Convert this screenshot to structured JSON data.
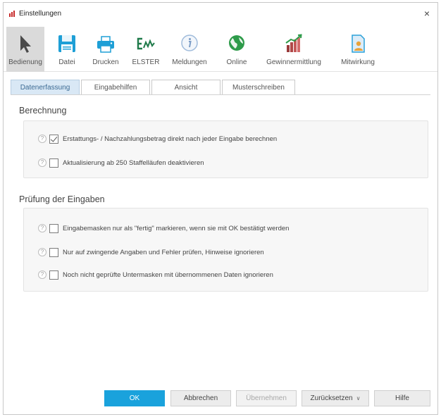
{
  "window": {
    "title": "Einstellungen",
    "close_glyph": "×"
  },
  "toolbar": {
    "items": [
      {
        "label": "Bedienung",
        "icon": "cursor-arrow-icon",
        "active": true
      },
      {
        "label": "Datei",
        "icon": "floppy-disk-icon"
      },
      {
        "label": "Drucken",
        "icon": "printer-icon"
      },
      {
        "label": "ELSTER",
        "icon": "elster-logo-icon"
      },
      {
        "label": "Meldungen",
        "icon": "info-icon"
      },
      {
        "label": "Online",
        "icon": "globe-icon"
      },
      {
        "label": "Gewinnermittlung",
        "icon": "bar-chart-icon"
      },
      {
        "label": "Mitwirkung",
        "icon": "document-person-icon"
      }
    ]
  },
  "tabs": [
    {
      "label": "Datenerfassung",
      "active": true
    },
    {
      "label": "Eingabehilfen"
    },
    {
      "label": "Ansicht"
    },
    {
      "label": "Musterschreiben"
    }
  ],
  "sections": {
    "berechnung": {
      "title": "Berechnung",
      "options": [
        {
          "label": "Erstattungs- / Nachzahlungsbetrag direkt nach jeder Eingabe berechnen",
          "checked": true
        },
        {
          "label": "Aktualisierung ab 250 Staffelläufen deaktivieren",
          "checked": false
        }
      ]
    },
    "pruefung": {
      "title": "Prüfung der Eingaben",
      "options": [
        {
          "label": "Eingabemasken nur als \"fertig\" markieren, wenn sie mit OK bestätigt werden",
          "checked": false
        },
        {
          "label": "Nur auf zwingende Angaben und Fehler prüfen, Hinweise ignorieren",
          "checked": false
        },
        {
          "label": "Noch nicht geprüfte Untermasken mit übernommenen Daten ignorieren",
          "checked": false
        }
      ]
    }
  },
  "help_glyph": "?",
  "footer": {
    "ok": "OK",
    "cancel": "Abbrechen",
    "apply": "Übernehmen",
    "reset": "Zurücksetzen",
    "reset_chevron": "∨",
    "help": "Hilfe"
  },
  "colors": {
    "primary_button": "#1aa2dc",
    "active_tab": "#d9e8f5",
    "active_toolbar": "#dadada",
    "elster_green": "#1f7a4a"
  }
}
